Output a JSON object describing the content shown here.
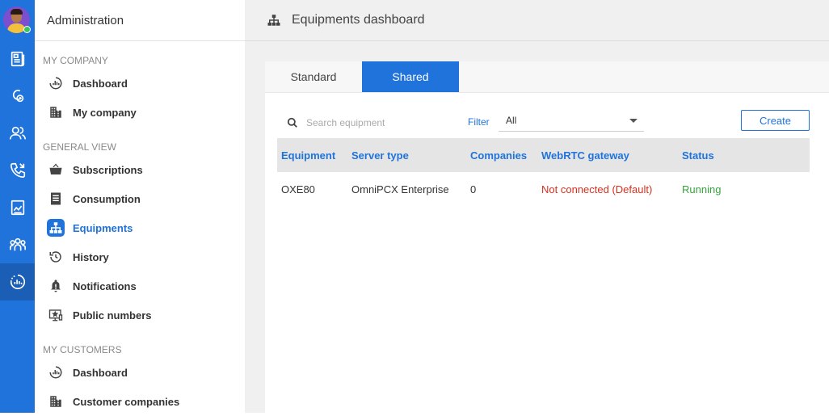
{
  "rail": {
    "items": [
      {
        "name": "news-icon"
      },
      {
        "name": "telephony-settings-icon"
      },
      {
        "name": "users-icon"
      },
      {
        "name": "phone-call-icon"
      },
      {
        "name": "report-icon"
      },
      {
        "name": "groups-icon"
      },
      {
        "name": "dashboard-icon",
        "active": true
      }
    ],
    "accent": "#1f73da"
  },
  "sidebar": {
    "title": "Administration",
    "sections": [
      {
        "title": "MY COMPANY",
        "items": [
          {
            "label": "Dashboard"
          },
          {
            "label": "My company"
          }
        ]
      },
      {
        "title": "GENERAL VIEW",
        "items": [
          {
            "label": "Subscriptions"
          },
          {
            "label": "Consumption"
          },
          {
            "label": "Equipments",
            "active": true
          },
          {
            "label": "History"
          },
          {
            "label": "Notifications"
          },
          {
            "label": "Public numbers"
          }
        ]
      },
      {
        "title": "MY CUSTOMERS",
        "items": [
          {
            "label": "Dashboard"
          },
          {
            "label": "Customer companies"
          }
        ]
      }
    ]
  },
  "main": {
    "title": "Equipments dashboard",
    "tabs": [
      {
        "label": "Standard",
        "active": false
      },
      {
        "label": "Shared",
        "active": true
      }
    ],
    "search": {
      "placeholder": "Search equipment",
      "value": ""
    },
    "filter": {
      "label": "Filter",
      "value": "All"
    },
    "create_label": "Create",
    "table": {
      "columns": [
        "Equipment",
        "Server type",
        "Companies",
        "WebRTC gateway",
        "Status"
      ],
      "rows": [
        [
          "OXE80",
          "OmniPCX Enterprise",
          "0",
          "Not connected (Default)",
          "Running"
        ]
      ]
    },
    "colors": {
      "gateway_error": "#d6301f",
      "status_ok": "#35a43c"
    }
  }
}
